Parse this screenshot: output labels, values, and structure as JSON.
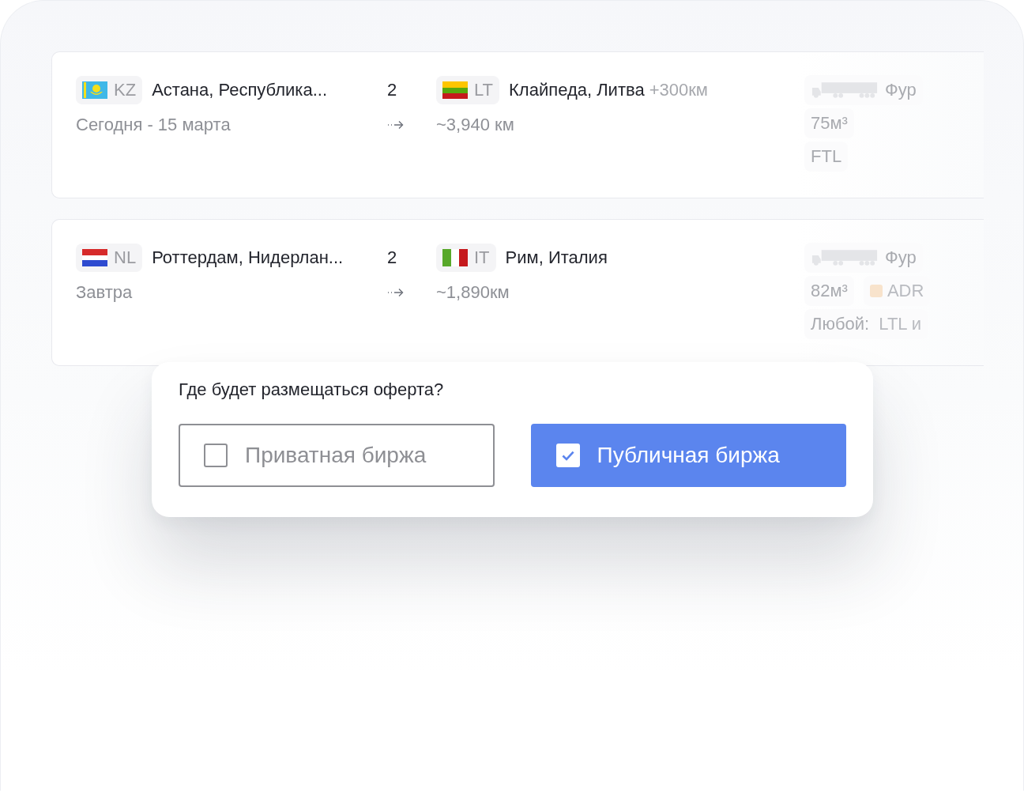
{
  "routes": [
    {
      "origin": {
        "kind": "kz",
        "code": "KZ",
        "city": "Астана, Республика..."
      },
      "date": "Сегодня - 15 марта",
      "count": "2",
      "destination": {
        "kind": "lt",
        "code": "LT",
        "city": "Клайпеда, Литва",
        "extra": "+300км"
      },
      "distance": "~3,940 км",
      "vehicle": "Фур",
      "spec_rows": [
        [
          {
            "kind": "plain",
            "text": "75м³"
          }
        ],
        [
          {
            "kind": "plain",
            "text": "FTL"
          }
        ]
      ]
    },
    {
      "origin": {
        "kind": "nl",
        "code": "NL",
        "city": "Роттердам, Нидерлан..."
      },
      "date": "Завтра",
      "count": "2",
      "destination": {
        "kind": "it",
        "code": "IT",
        "city": "Рим, Италия"
      },
      "distance": "~1,890км",
      "vehicle": "Фур",
      "spec_rows": [
        [
          {
            "kind": "plain",
            "text": "82м³"
          },
          {
            "kind": "dot",
            "text": "ADR",
            "color": "#f8e3cc"
          }
        ],
        [
          {
            "kind": "labeled",
            "label": "Любой:",
            "text": "LTL и"
          }
        ]
      ]
    }
  ],
  "dialog": {
    "question": "Где будет размещаться оферта?",
    "options": [
      {
        "label": "Приватная биржа",
        "checked": false
      },
      {
        "label": "Публичная биржа",
        "checked": true
      }
    ]
  }
}
